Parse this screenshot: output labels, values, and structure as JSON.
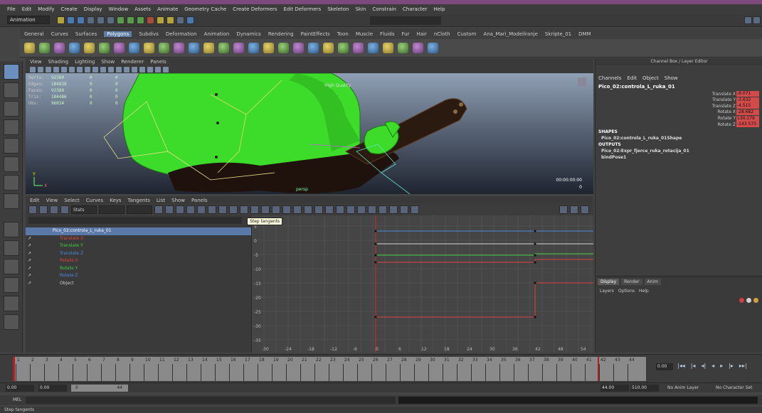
{
  "menubar": [
    "File",
    "Edit",
    "Modify",
    "Create",
    "Display",
    "Window",
    "Assets",
    "Animate",
    "Geometry Cache",
    "Create Deformers",
    "Edit Deformers",
    "Skeleton",
    "Skin",
    "Constrain",
    "Character",
    "Help"
  ],
  "status": {
    "mode": "Animation"
  },
  "shelf_tabs": [
    "General",
    "Curves",
    "Surfaces",
    "Polygons",
    "Subdivs",
    "Deformation",
    "Animation",
    "Dynamics",
    "Rendering",
    "PaintEffects",
    "Toon",
    "Muscle",
    "Fluids",
    "Fur",
    "Hair",
    "nCloth",
    "Custom",
    "Ana_Mari_Modeliranje",
    "Skripte_01",
    "DMM"
  ],
  "shelf_active": "Polygons",
  "viewport": {
    "menu": [
      "View",
      "Shading",
      "Lighting",
      "Show",
      "Renderer",
      "Panels"
    ],
    "hud": [
      {
        "label": "Verts:",
        "v1": "92380",
        "v2": "0",
        "v3": "0"
      },
      {
        "label": "Edges:",
        "v1": "184838",
        "v2": "0",
        "v3": "0"
      },
      {
        "label": "Faces:",
        "v1": "92389",
        "v2": "0",
        "v3": "0"
      },
      {
        "label": "Tris:",
        "v1": "184486",
        "v2": "0",
        "v3": "0"
      },
      {
        "label": "UVs:",
        "v1": "96034",
        "v2": "0",
        "v3": "0"
      }
    ],
    "quality": "High Quality",
    "camera": "persp",
    "timecode": "00:00:00:00",
    "frame": "0"
  },
  "graph_editor": {
    "menu": [
      "Edit",
      "View",
      "Select",
      "Curves",
      "Keys",
      "Tangents",
      "List",
      "Show",
      "Panels"
    ],
    "stats_label": "Stats",
    "tooltip": "Step tangents",
    "outliner": {
      "root": "Pico_02:controla_L_ruka_01",
      "items": [
        {
          "label": "Translate X",
          "color": "#e04040"
        },
        {
          "label": "Translate Y",
          "color": "#40d040"
        },
        {
          "label": "Translate Z",
          "color": "#4a8ae0"
        },
        {
          "label": "Rotate X",
          "color": "#e04040"
        },
        {
          "label": "Rotate Y",
          "color": "#40d040"
        },
        {
          "label": "Rotate Z",
          "color": "#4a8ae0"
        },
        {
          "label": "Object",
          "color": "#cccccc"
        }
      ]
    },
    "y_ticks": [
      "5",
      "0",
      "-5",
      "-10",
      "-15",
      "-20",
      "-25",
      "-30",
      "-35"
    ],
    "x_ticks": [
      "-30",
      "-24",
      "-18",
      "-12",
      "-6",
      "0",
      "6",
      "12",
      "18",
      "24",
      "30",
      "36",
      "42",
      "48",
      "54"
    ]
  },
  "channel_box": {
    "title": "Channel Box / Layer Editor",
    "tabs": [
      "Channels",
      "Edit",
      "Object",
      "Show"
    ],
    "node": "Pico_02:controla_L_ruka_01",
    "attributes": [
      {
        "name": "Translate X",
        "value": "-6.071"
      },
      {
        "name": "Translate Y",
        "value": "-3.632"
      },
      {
        "name": "Translate Z",
        "value": "-4.515"
      },
      {
        "name": "Rotate X",
        "value": "-28.682"
      },
      {
        "name": "Rotate Y",
        "value": "130.179"
      },
      {
        "name": "Rotate Z",
        "value": "-143.573"
      }
    ],
    "shapes_header": "SHAPES",
    "shape": "Pico_02:controla_L_ruka_01Shape",
    "outputs_header": "OUTPUTS",
    "outputs": [
      "Pico_02:Expr_fjerce_ruka_rotacija_01",
      "bindPose1"
    ]
  },
  "layer_editor": {
    "tabs": [
      "Display",
      "Render",
      "Anim"
    ],
    "active_tab": "Display",
    "menu": [
      "Layers",
      "Options",
      "Help"
    ]
  },
  "time_slider": {
    "ticks": [
      "1",
      "2",
      "3",
      "4",
      "5",
      "6",
      "7",
      "8",
      "9",
      "10",
      "11",
      "12",
      "13",
      "14",
      "15",
      "16",
      "17",
      "18",
      "19",
      "20",
      "21",
      "22",
      "23",
      "24",
      "25",
      "26",
      "27",
      "28",
      "29",
      "30",
      "31",
      "32",
      "33",
      "34",
      "35",
      "36",
      "37",
      "38",
      "39",
      "40",
      "41",
      "42",
      "43",
      "44"
    ],
    "current": "0.00",
    "play_controls": [
      "|◂◂",
      "|◂",
      "◂|",
      "◂",
      "▸",
      "|▸",
      "▸▸|"
    ]
  },
  "range_slider": {
    "start": "0.00",
    "start2": "0.00",
    "range_start": "0",
    "range_end": "44",
    "end": "44.00",
    "end2": "510.00",
    "anim_layer": "No Anim Layer",
    "character_set": "No Character Set"
  },
  "mel_label": "MEL",
  "help_line": "Step tangents",
  "colors": {
    "accent": "#5e7ea6",
    "key_red": "#d24a4a",
    "curve_red": "#e04040",
    "curve_green": "#40d040",
    "curve_blue": "#4a8ae0",
    "character_green": "#3ddc2a"
  }
}
